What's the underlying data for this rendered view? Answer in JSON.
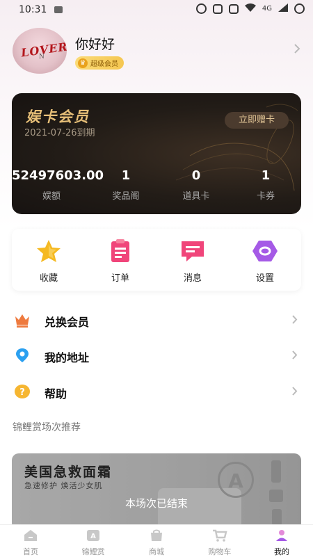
{
  "status_bar": {
    "time": "10:31",
    "network": "4G"
  },
  "profile": {
    "username": "你好好",
    "member_badge": "超级会员",
    "avatar_text": "LOVER",
    "avatar_sub": "N"
  },
  "card": {
    "title": "娱卡会员",
    "expire": "2021-07-26到期",
    "gift_button": "立即赠卡",
    "stats": [
      {
        "value": "52497603.00",
        "label": "娱额"
      },
      {
        "value": "1",
        "label": "奖品阁"
      },
      {
        "value": "0",
        "label": "道具卡"
      },
      {
        "value": "1",
        "label": "卡券"
      }
    ]
  },
  "quick_actions": [
    {
      "label": "收藏",
      "icon": "star-icon",
      "color": "#f5b921"
    },
    {
      "label": "订单",
      "icon": "clipboard-icon",
      "color": "#f0457a"
    },
    {
      "label": "消息",
      "icon": "message-icon",
      "color": "#f0457a"
    },
    {
      "label": "设置",
      "icon": "settings-icon",
      "color": "#a55ae6"
    }
  ],
  "menu": [
    {
      "label": "兑换会员",
      "icon": "crown-icon",
      "color": "#ee7a3e"
    },
    {
      "label": "我的地址",
      "icon": "location-icon",
      "color": "#2ba0f0"
    },
    {
      "label": "帮助",
      "icon": "help-icon",
      "color": "#f6b631"
    }
  ],
  "recommend": {
    "section_title": "锦鲤赏场次推荐",
    "product_title": "美国急救面霜",
    "product_subtitle": "急速修护 焕活少女肌",
    "status": "本场次已结束",
    "logo_letter": "A"
  },
  "bottom_nav": [
    {
      "label": "首页",
      "icon": "home-icon",
      "active": false
    },
    {
      "label": "锦鲤赏",
      "icon": "lottery-icon",
      "active": false
    },
    {
      "label": "商城",
      "icon": "shop-icon",
      "active": false
    },
    {
      "label": "购物车",
      "icon": "cart-icon",
      "active": false
    },
    {
      "label": "我的",
      "icon": "profile-icon",
      "active": true
    }
  ]
}
